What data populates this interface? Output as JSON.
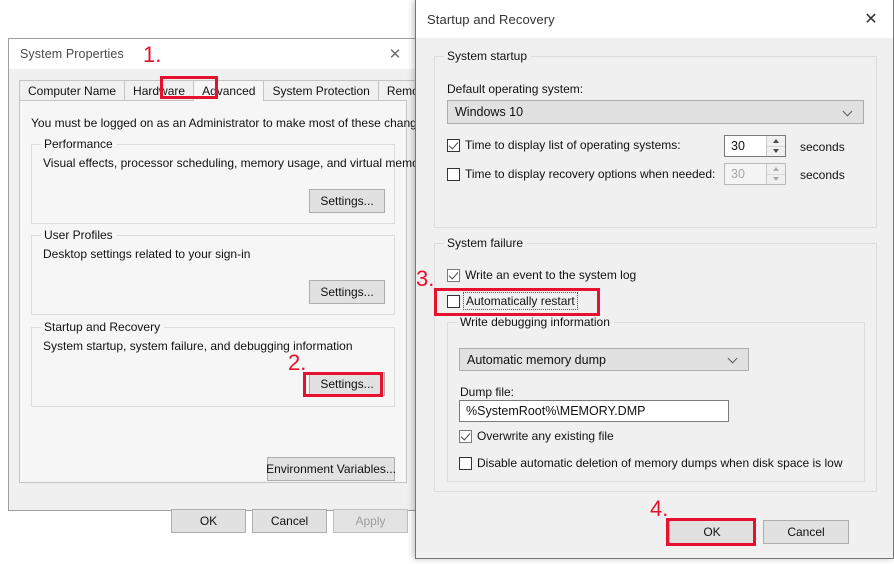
{
  "system_properties": {
    "title": "System Properties",
    "close_icon": "close-icon",
    "tabs": [
      {
        "label": "Computer Name",
        "selected": false
      },
      {
        "label": "Hardware",
        "selected": false
      },
      {
        "label": "Advanced",
        "selected": true
      },
      {
        "label": "System Protection",
        "selected": false
      },
      {
        "label": "Remote",
        "selected": false
      }
    ],
    "intro": "You must be logged on as an Administrator to make most of these changes.",
    "groups": [
      {
        "legend": "Performance",
        "description": "Visual effects, processor scheduling, memory usage, and virtual memory",
        "button": "Settings..."
      },
      {
        "legend": "User Profiles",
        "description": "Desktop settings related to your sign-in",
        "button": "Settings..."
      },
      {
        "legend": "Startup and Recovery",
        "description": "System startup, system failure, and debugging information",
        "button": "Settings..."
      }
    ],
    "env_button": "Environment Variables...",
    "footer": {
      "ok": "OK",
      "cancel": "Cancel",
      "apply": "Apply"
    }
  },
  "startup_recovery": {
    "title": "Startup and Recovery",
    "close_icon": "close-icon",
    "system_startup": {
      "legend": "System startup",
      "default_os_label": "Default operating system:",
      "default_os_value": "Windows 10",
      "timeout_os": {
        "label_pre": "T",
        "label_underline": "i",
        "label_post": "me to display list of operating systems:",
        "label_full": "Time to display list of operating systems:",
        "checked": true,
        "value": "30",
        "unit": "seconds"
      },
      "timeout_recovery": {
        "label_full": "Time to display recovery options when needed:",
        "checked": false,
        "value": "30",
        "unit": "seconds"
      }
    },
    "system_failure": {
      "legend": "System failure",
      "write_event": {
        "label": "Write an event to the system log",
        "checked": true
      },
      "auto_restart": {
        "label": "Automatically restart",
        "checked": false
      },
      "debug_group": {
        "legend": "Write debugging information",
        "dump_type": "Automatic memory dump",
        "dump_file_label": "Dump file:",
        "dump_file_value": "%SystemRoot%\\MEMORY.DMP",
        "overwrite": {
          "label": "Overwrite any existing file",
          "checked": true
        },
        "disable_deletion": {
          "label": "Disable automatic deletion of memory dumps when disk space is low",
          "checked": false
        }
      }
    },
    "footer": {
      "ok": "OK",
      "cancel": "Cancel"
    }
  },
  "annotations": {
    "step1": "1.",
    "step2": "2.",
    "step3": "3.",
    "step4": "4.",
    "color": "#e8112d"
  }
}
